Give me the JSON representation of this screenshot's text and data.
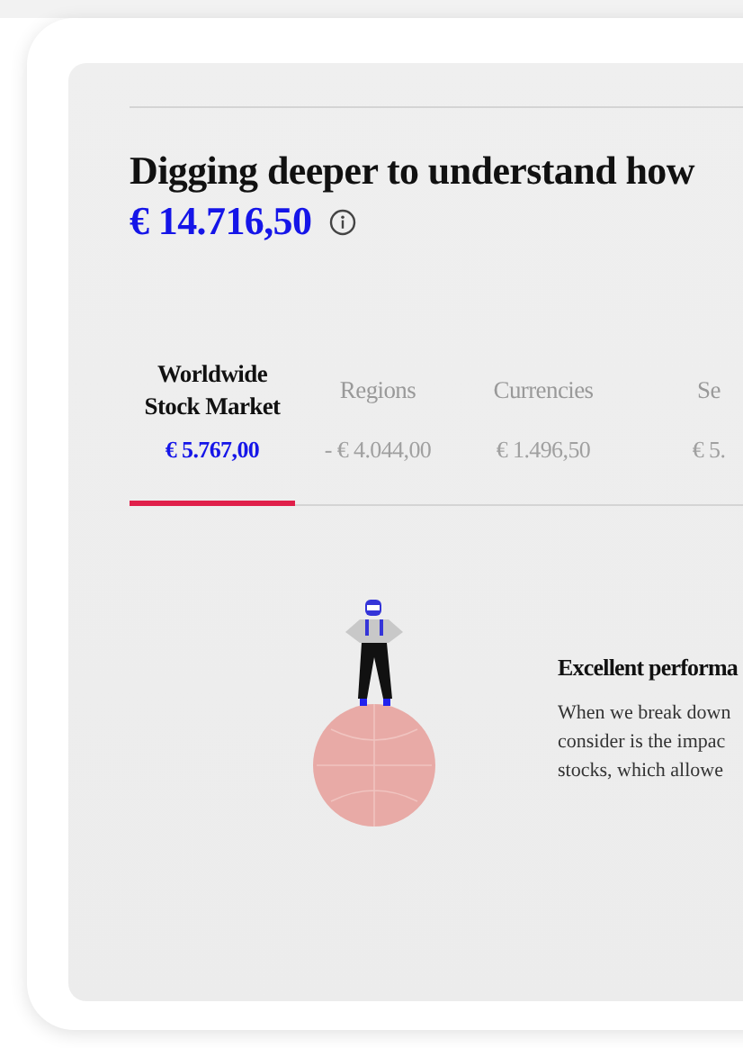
{
  "heading": "Digging deeper to understand how",
  "total": {
    "amount": "€ 14.716,50"
  },
  "tabs": [
    {
      "label": "Worldwide\nStock Market",
      "amount": "€ 5.767,00",
      "selected": true
    },
    {
      "label": "Regions",
      "amount": "- € 4.044,00",
      "selected": false
    },
    {
      "label": "Currencies",
      "amount": "€ 1.496,50",
      "selected": false
    },
    {
      "label": "Se",
      "amount": "€ 5.",
      "selected": false
    }
  ],
  "insight": {
    "title": "Excellent performa",
    "body": "When we break down\nconsider is the impac\nstocks, which allowe"
  }
}
